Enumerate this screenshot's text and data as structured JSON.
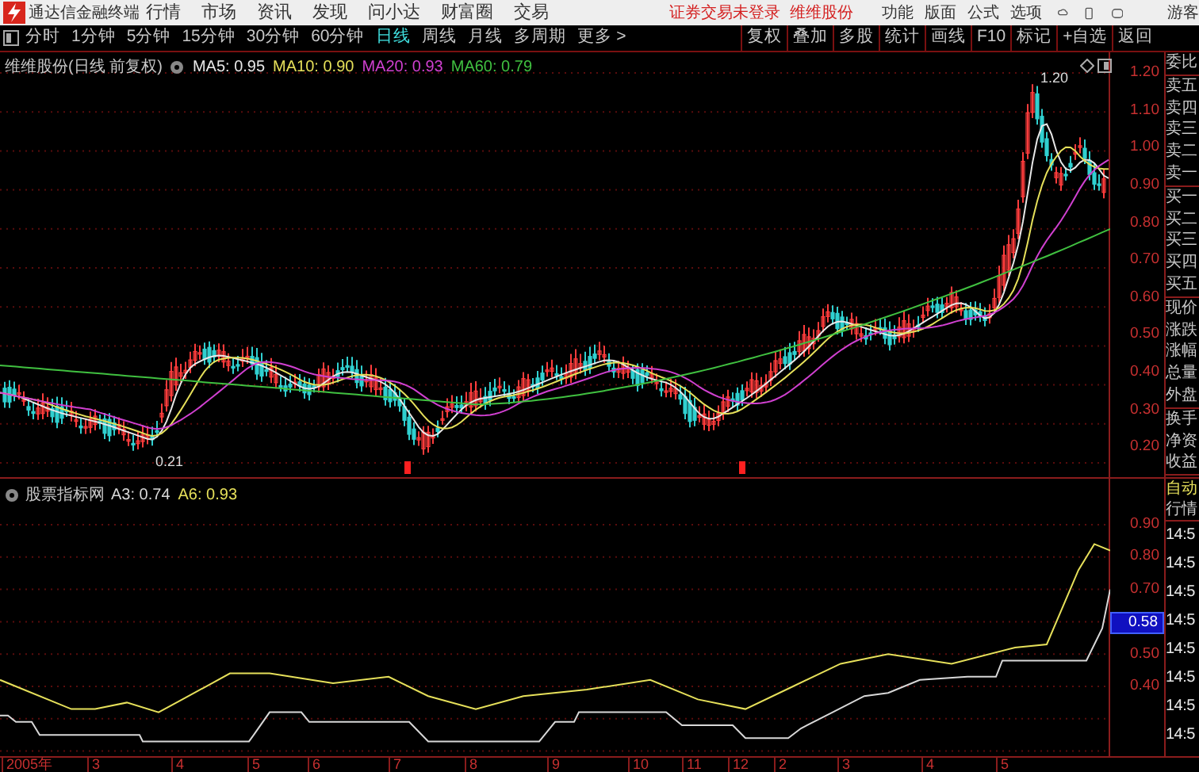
{
  "title_bar": {
    "app_name": "通达信金融终端",
    "menu": [
      "行情",
      "市场",
      "资讯",
      "发现",
      "问小达",
      "财富圈",
      "交易"
    ],
    "login_notice": "证券交易未登录",
    "stock_name": "维维股份",
    "right_menu": [
      "功能",
      "版面",
      "公式",
      "选项"
    ],
    "user": "游客"
  },
  "period_bar": {
    "periods": [
      {
        "label": "分时",
        "selected": false
      },
      {
        "label": "1分钟",
        "selected": false
      },
      {
        "label": "5分钟",
        "selected": false
      },
      {
        "label": "15分钟",
        "selected": false
      },
      {
        "label": "30分钟",
        "selected": false
      },
      {
        "label": "60分钟",
        "selected": false
      },
      {
        "label": "日线",
        "selected": true
      },
      {
        "label": "周线",
        "selected": false
      },
      {
        "label": "月线",
        "selected": false
      },
      {
        "label": "多周期",
        "selected": false
      },
      {
        "label": "更多 >",
        "selected": false
      }
    ],
    "tools": [
      "复权",
      "叠加",
      "多股",
      "统计",
      "画线",
      "F10",
      "标记",
      "+自选",
      "返回"
    ]
  },
  "main_chart": {
    "title": "维维股份(日线 前复权)",
    "indicators": [
      {
        "label": "MA5: 0.95",
        "color": "#e8e8e8"
      },
      {
        "label": "MA10: 0.90",
        "color": "#e6e05a"
      },
      {
        "label": "MA20: 0.93",
        "color": "#d040d0"
      },
      {
        "label": "MA60: 0.79",
        "color": "#40c040"
      }
    ],
    "high_label": "1.20",
    "low_label": "0.21",
    "y_ticks": [
      "1.20",
      "1.10",
      "1.00",
      "0.90",
      "0.80",
      "0.70",
      "0.60",
      "0.50",
      "0.40",
      "0.30",
      "0.20"
    ]
  },
  "quote_panel": {
    "groups": [
      [
        "委比"
      ],
      [
        "卖五",
        "卖四",
        "卖三",
        "卖二",
        "卖一"
      ],
      [
        "买一",
        "买二",
        "买三",
        "买四",
        "买五"
      ],
      [
        "现价",
        "涨跌",
        "涨幅",
        "总量",
        "外盘"
      ],
      [
        "换手",
        "净资",
        "收益"
      ]
    ]
  },
  "sub_chart": {
    "title": "股票指标网",
    "indicators": [
      {
        "label": "A3: 0.74",
        "color": "#d8d8d8"
      },
      {
        "label": "A6: 0.93",
        "color": "#e6e05a"
      }
    ],
    "y_ticks": [
      {
        "label": "0.90",
        "kind": "tick"
      },
      {
        "label": "0.80",
        "kind": "tick"
      },
      {
        "label": "0.70",
        "kind": "tick"
      },
      {
        "label": "0.58",
        "kind": "current"
      },
      {
        "label": "0.50",
        "kind": "tick"
      },
      {
        "label": "0.40",
        "kind": "tick"
      }
    ]
  },
  "tick_panel": {
    "mode": "自动",
    "header": "行情",
    "times": [
      "14:5",
      "14:5",
      "14:5",
      "14:5",
      "14:5",
      "14:5",
      "14:5",
      "14:5"
    ]
  },
  "x_axis": [
    "2005年",
    "3",
    "4",
    "5",
    "6",
    "7",
    "8",
    "9",
    "10",
    "11",
    "12",
    "2",
    "3",
    "4",
    "5"
  ]
}
